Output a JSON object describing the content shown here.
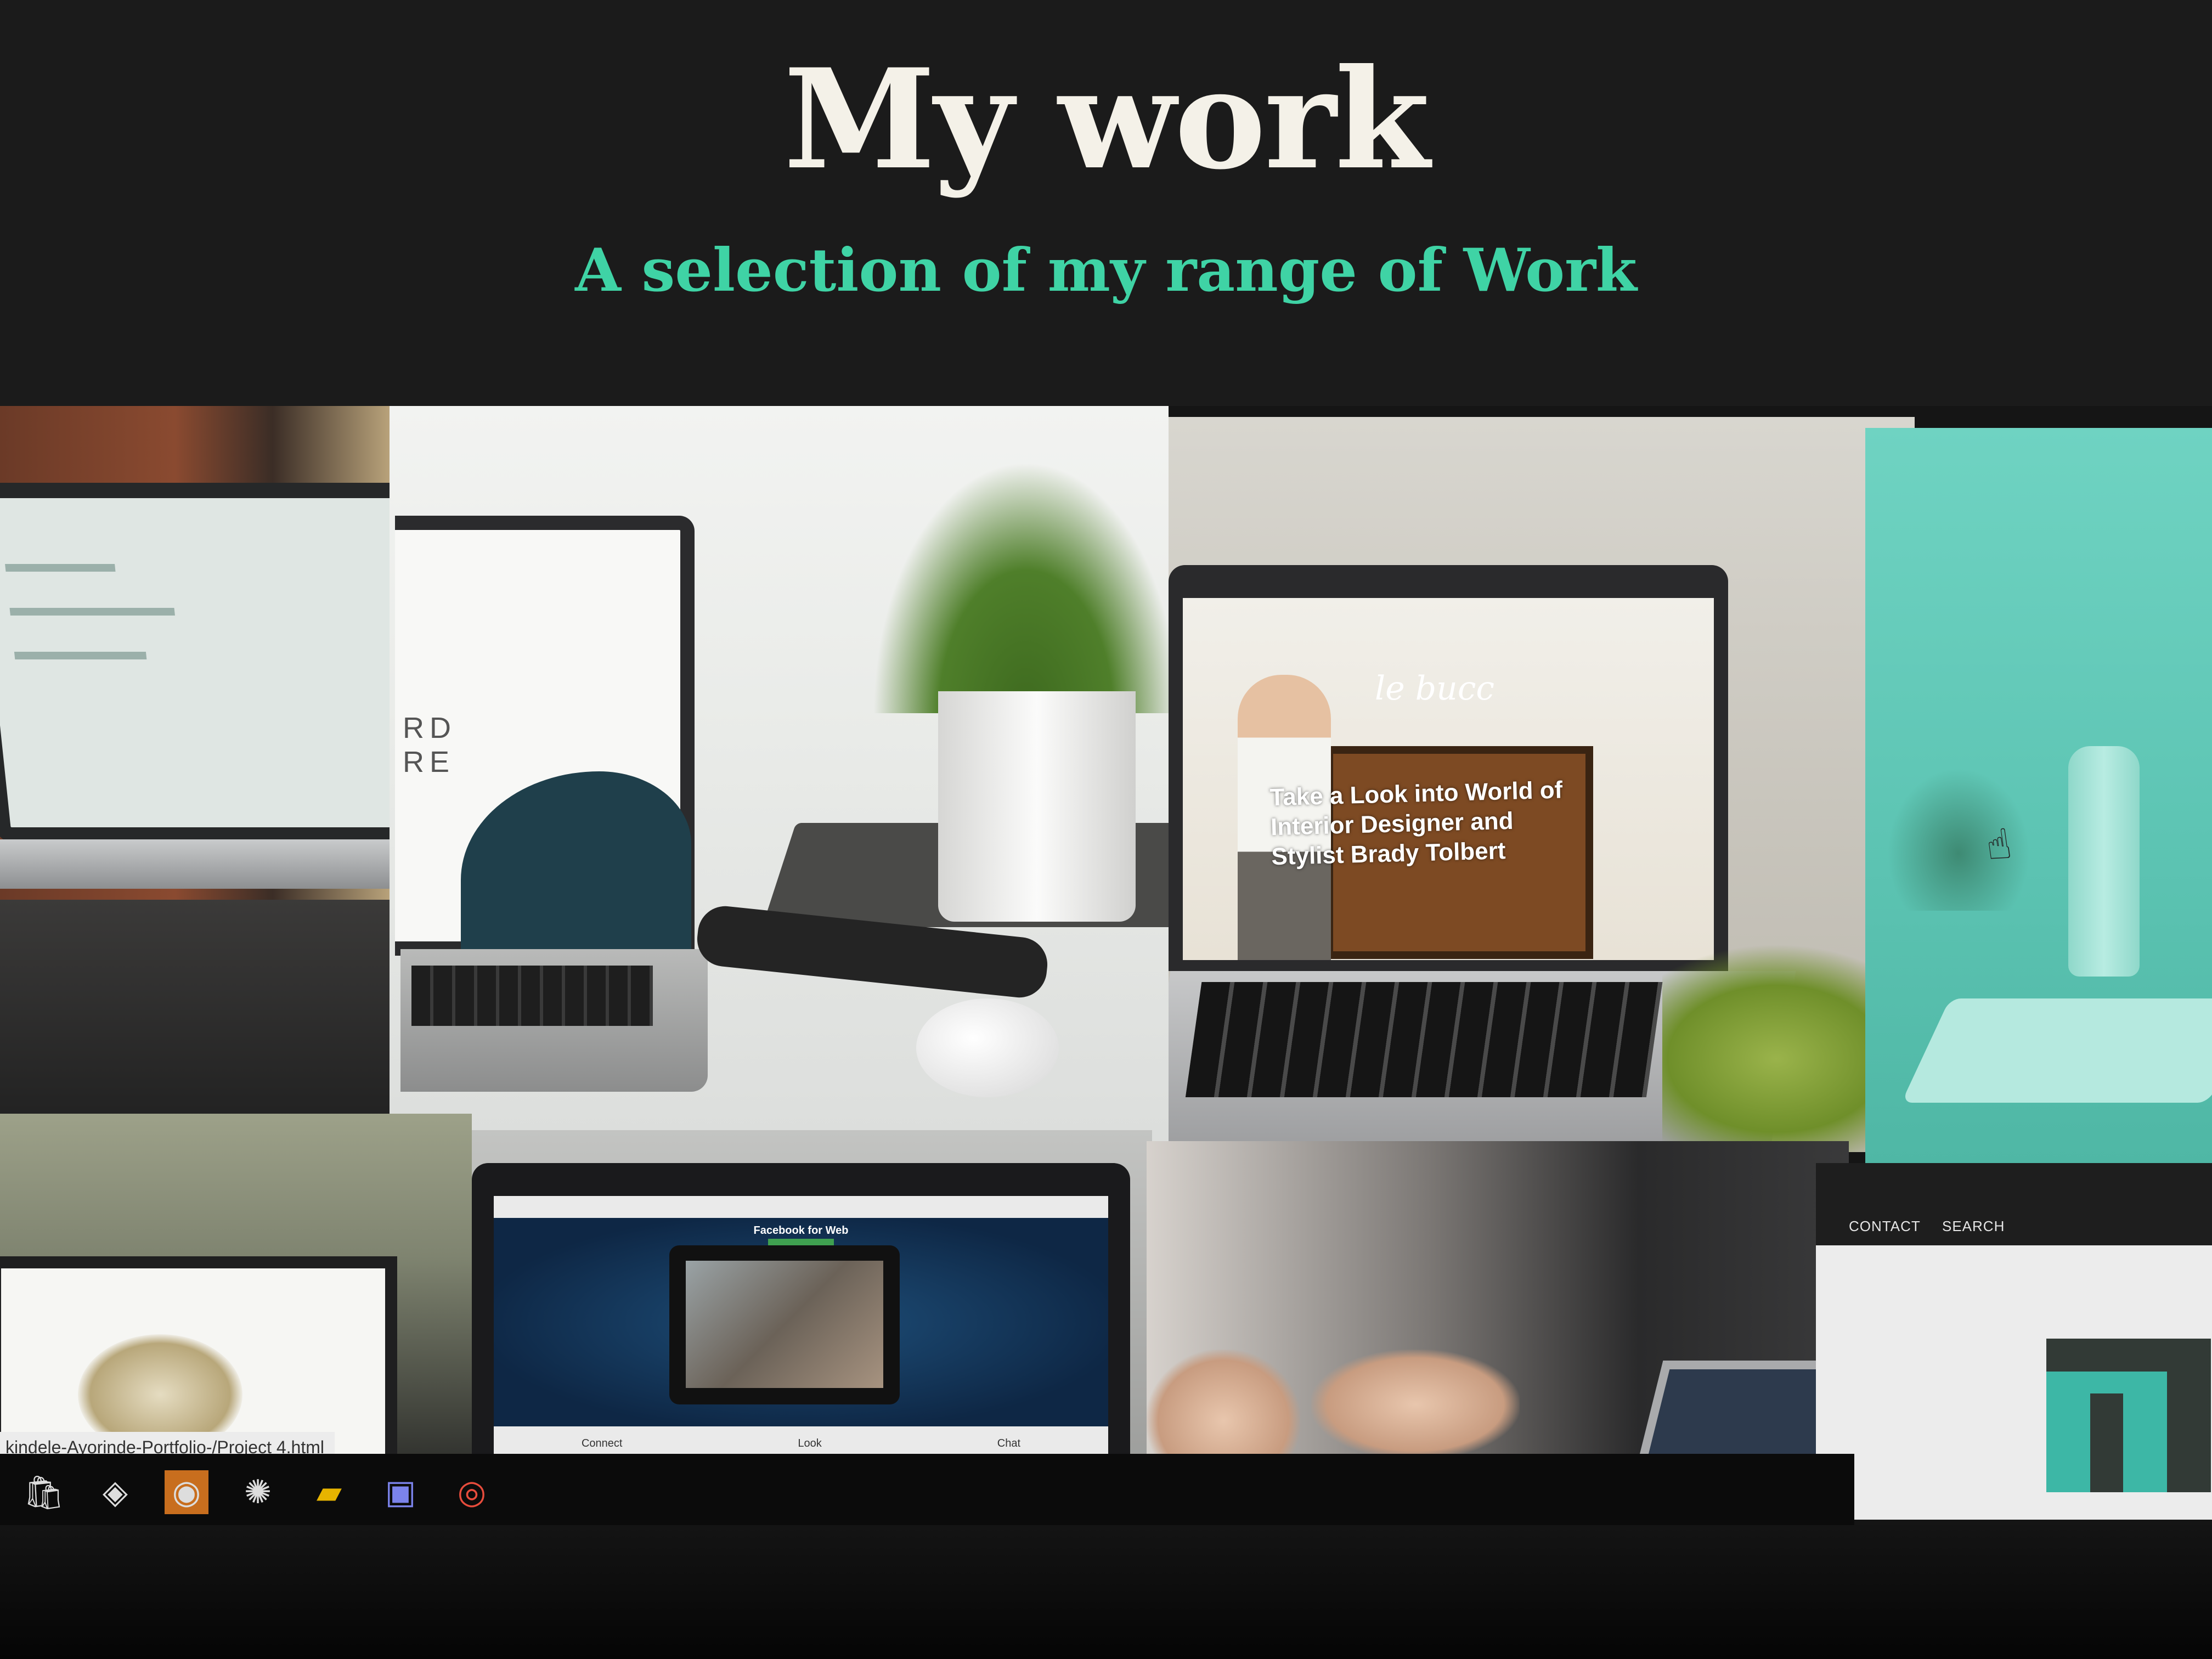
{
  "page": {
    "title": "My work",
    "subtitle": "A selection of my range of Work"
  },
  "tiles": {
    "t2_word": "RD\nRE",
    "t3_logo": "le bucc",
    "t3_headline": "Take a Look into World of Interior Designer and Stylist Brady Tolbert",
    "b1_url": "kindele-Ayorinde-Portfolio-/Project 4.html",
    "b2_title": "Facebook for Web",
    "b2_footer": [
      "Connect",
      "Look",
      "Chat"
    ],
    "b4_nav": [
      "CONTACT",
      "SEARCH"
    ]
  },
  "taskbar": {
    "icons": [
      "store-icon",
      "dropbox-icon",
      "edge-icon",
      "dragon-icon",
      "folder-icon",
      "teams-icon",
      "chrome-icon"
    ]
  },
  "colors": {
    "background": "#1b1b1b",
    "title": "#f4f1e8",
    "subtitle_accent": "#3fd3a5",
    "teal_tile": "#5fc6b5"
  }
}
